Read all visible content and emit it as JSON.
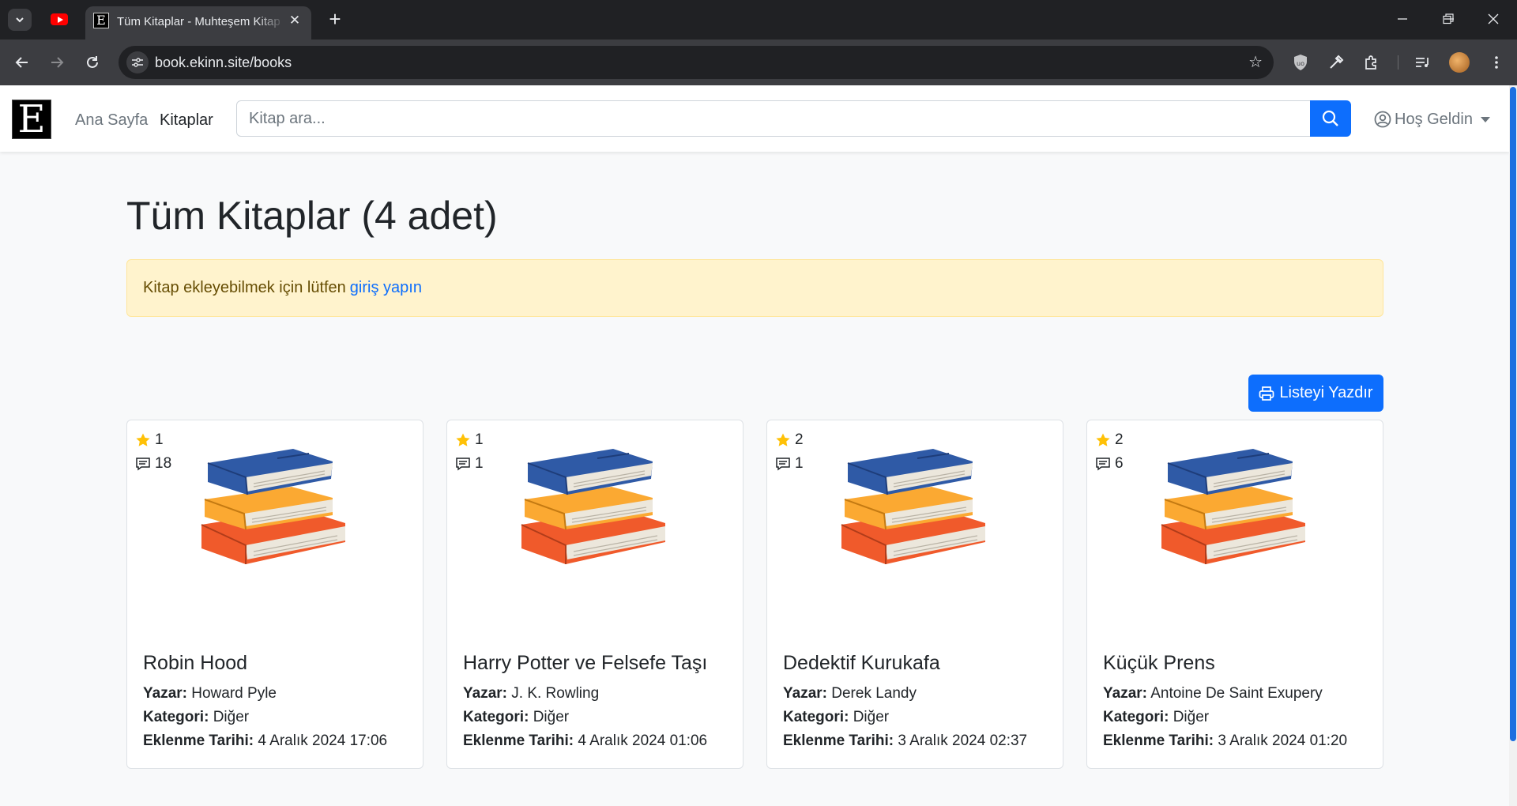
{
  "browser": {
    "tab_title": "Tüm Kitaplar - Muhteşem Kitap Sitesi",
    "tab_favicon_letter": "E",
    "url": "book.ekinn.site/books",
    "icons": [
      "youtube-icon",
      "bookmark-star-icon",
      "ublock-icon",
      "eyedropper-icon",
      "extensions-icon",
      "media-icon",
      "avatar"
    ]
  },
  "navbar": {
    "brand_letter": "E",
    "links": [
      {
        "label": "Ana Sayfa",
        "active": false
      },
      {
        "label": "Kitaplar",
        "active": true
      }
    ],
    "search_placeholder": "Kitap ara...",
    "user_label": "Hoş Geldin"
  },
  "page": {
    "title": "Tüm Kitaplar (4 adet)",
    "alert_text": "Kitap ekleyebilmek için lütfen",
    "alert_link": "giriş yapın",
    "print_label": "Listeyi Yazdır"
  },
  "labels": {
    "author": "Yazar:",
    "category": "Kategori:",
    "date": "Eklenme Tarihi:"
  },
  "books": [
    {
      "title": "Robin Hood",
      "author": "Howard Pyle",
      "category": "Diğer",
      "date": "4 Aralık 2024 17:06",
      "rating": "1",
      "comments": "18"
    },
    {
      "title": "Harry Potter ve Felsefe Taşı",
      "author": "J. K. Rowling",
      "category": "Diğer",
      "date": "4 Aralık 2024 01:06",
      "rating": "1",
      "comments": "1"
    },
    {
      "title": "Dedektif Kurukafa",
      "author": "Derek Landy",
      "category": "Diğer",
      "date": "3 Aralık 2024 02:37",
      "rating": "2",
      "comments": "1"
    },
    {
      "title": "Küçük Prens",
      "author": "Antoine De Saint Exupery",
      "category": "Diğer",
      "date": "3 Aralık 2024 01:20",
      "rating": "2",
      "comments": "6"
    }
  ],
  "colors": {
    "primary": "#0d6efd",
    "alert_bg": "#fff3cd",
    "star": "#ffc107",
    "book_blue": "#2f5aa6",
    "book_yellow": "#fba932",
    "book_red": "#f05a2b"
  }
}
